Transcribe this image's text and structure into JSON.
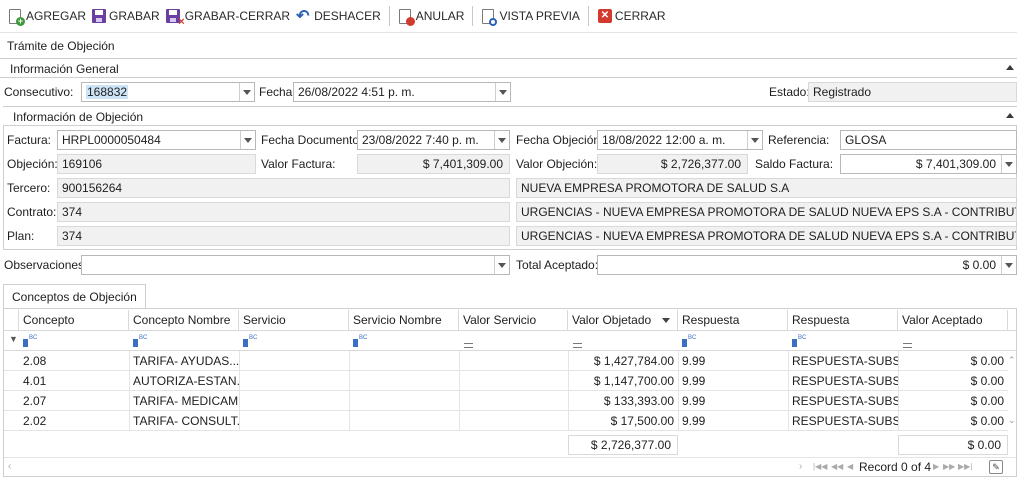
{
  "toolbar": {
    "add": "AGREGAR",
    "save": "GRABAR",
    "save_close": "GRABAR-CERRAR",
    "undo": "DESHACER",
    "void": "ANULAR",
    "preview": "VISTA PREVIA",
    "close": "CERRAR"
  },
  "window_title": "Trámite de Objeción",
  "general": {
    "header": "Información General",
    "consecutivo_label": "Consecutivo:",
    "consecutivo_value": "168832",
    "fecha_label": "Fecha:",
    "fecha_value": "26/08/2022 4:51 p. m.",
    "estado_label": "Estado:",
    "estado_value": "Registrado"
  },
  "objecion": {
    "header": "Información de Objeción",
    "factura_label": "Factura:",
    "factura_value": "HRPL0000050484",
    "fecha_doc_label": "Fecha Documento:",
    "fecha_doc_value": "23/08/2022 7:40 p. m.",
    "fecha_obj_label": "Fecha Objeción:",
    "fecha_obj_value": "18/08/2022 12:00 a. m.",
    "referencia_label": "Referencia:",
    "referencia_value": "GLOSA",
    "objecion_label": "Objeción:",
    "objecion_value": "169106",
    "valor_factura_label": "Valor Factura:",
    "valor_factura_value": "$ 7,401,309.00",
    "valor_objecion_label": "Valor Objeción:",
    "valor_objecion_value": "$ 2,726,377.00",
    "saldo_factura_label": "Saldo Factura:",
    "saldo_factura_value": "$ 7,401,309.00",
    "tercero_label": "Tercero:",
    "tercero_value": "900156264",
    "tercero_name": "NUEVA EMPRESA PROMOTORA DE SALUD S.A",
    "contrato_label": "Contrato:",
    "contrato_value": "374",
    "contrato_name": "URGENCIAS - NUEVA EMPRESA PROMOTORA DE SALUD NUEVA EPS S.A - CONTRIBUTIVO",
    "plan_label": "Plan:",
    "plan_value": "374",
    "plan_name": "URGENCIAS - NUEVA EMPRESA PROMOTORA DE SALUD NUEVA EPS S.A - CONTRIBUTIVO"
  },
  "observaciones_label": "Observaciones:",
  "observaciones_value": "",
  "total_aceptado_label": "Total Aceptado:",
  "total_aceptado_value": "$ 0.00",
  "tab_label": "Conceptos de Objeción",
  "grid": {
    "headers": [
      "Concepto",
      "Concepto Nombre",
      "Servicio",
      "Servicio Nombre",
      "Valor Servicio",
      "Valor Objetado",
      "Respuesta",
      "Respuesta",
      "Valor Aceptado"
    ],
    "rows": [
      [
        "2.08",
        "TARIFA- AYUDAS...",
        "",
        "",
        "",
        "$ 1,427,784.00",
        "9.99",
        "RESPUESTA-SUBS...",
        "$ 0.00"
      ],
      [
        "4.01",
        "AUTORIZA-ESTAN...",
        "",
        "",
        "",
        "$ 1,147,700.00",
        "9.99",
        "RESPUESTA-SUBS...",
        "$ 0.00"
      ],
      [
        "2.07",
        "TARIFA- MEDICAM...",
        "",
        "",
        "",
        "$ 133,393.00",
        "9.99",
        "RESPUESTA-SUBS...",
        "$ 0.00"
      ],
      [
        "2.02",
        "TARIFA- CONSULT...",
        "",
        "",
        "",
        "$ 17,500.00",
        "9.99",
        "RESPUESTA-SUBS...",
        "$ 0.00"
      ]
    ],
    "total_objetado": "$ 2,726,377.00",
    "total_aceptado": "$ 0.00",
    "record_text": "Record 0 of 4"
  }
}
